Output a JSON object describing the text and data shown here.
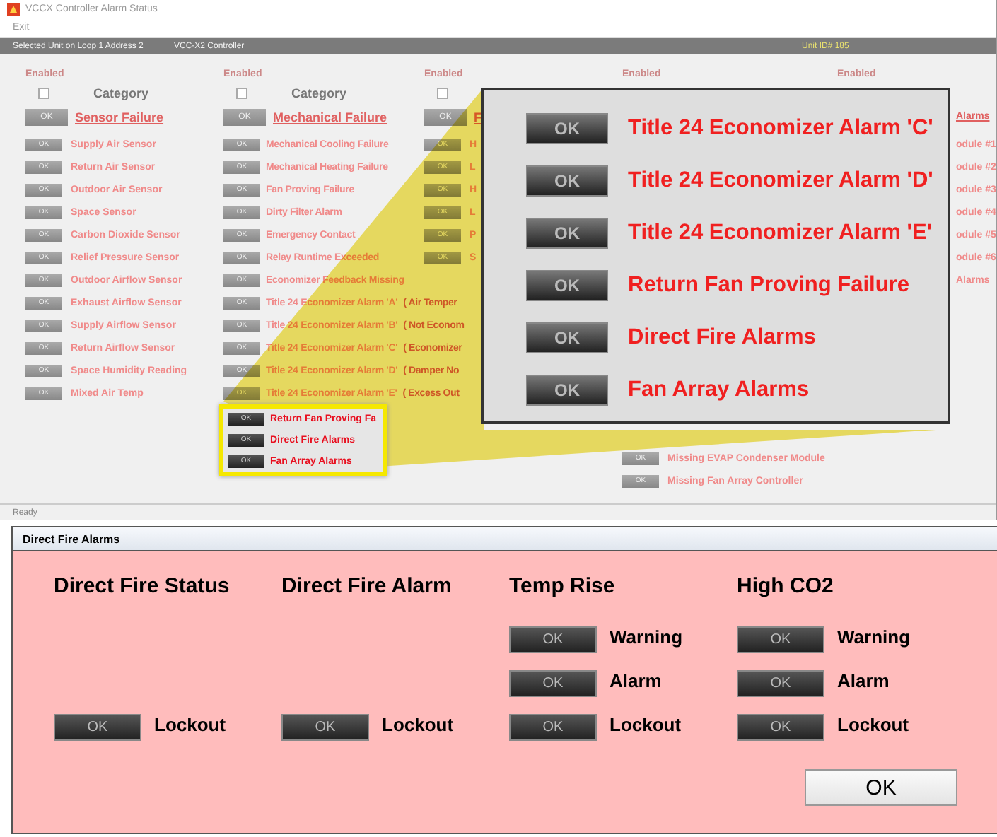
{
  "window": {
    "title": "VCCX Controller Alarm Status",
    "menu": [
      "Exit"
    ],
    "info_bar": {
      "unit_location": "Selected Unit on Loop 1 Address 2",
      "controller": "VCC-X2 Controller",
      "unit_id": "Unit ID# 185"
    },
    "status_bar": "Ready"
  },
  "columns": [
    {
      "kind": "full",
      "enabled_label": "Enabled",
      "checkbox": {
        "checked": false
      },
      "category_label": "Category",
      "category": {
        "button": "OK",
        "name": "Sensor Failure"
      },
      "items": [
        {
          "button": "OK",
          "label": "Supply Air Sensor"
        },
        {
          "button": "OK",
          "label": "Return Air Sensor"
        },
        {
          "button": "OK",
          "label": "Outdoor Air Sensor"
        },
        {
          "button": "OK",
          "label": "Space Sensor"
        },
        {
          "button": "OK",
          "label": "Carbon Dioxide Sensor"
        },
        {
          "button": "OK",
          "label": "Relief Pressure Sensor"
        },
        {
          "button": "OK",
          "label": "Outdoor Airflow Sensor"
        },
        {
          "button": "OK",
          "label": "Exhaust Airflow Sensor"
        },
        {
          "button": "OK",
          "label": "Supply Airflow Sensor"
        },
        {
          "button": "OK",
          "label": "Return Airflow Sensor"
        },
        {
          "button": "OK",
          "label": "Space Humidity Reading"
        },
        {
          "button": "OK",
          "label": "Mixed Air Temp"
        }
      ]
    },
    {
      "kind": "full",
      "enabled_label": "Enabled",
      "checkbox": {
        "checked": false
      },
      "category_label": "Category",
      "category": {
        "button": "OK",
        "name": "Mechanical Failure"
      },
      "items": [
        {
          "button": "OK",
          "label": "Mechanical Cooling Failure"
        },
        {
          "button": "OK",
          "label": "Mechanical Heating Failure"
        },
        {
          "button": "OK",
          "label": "Fan Proving Failure"
        },
        {
          "button": "OK",
          "label": "Dirty Filter Alarm"
        },
        {
          "button": "OK",
          "label": "Emergency Contact"
        },
        {
          "button": "OK",
          "label": "Relay Runtime Exceeded"
        },
        {
          "button": "OK",
          "label": "Economizer Feedback Missing"
        },
        {
          "button": "OK",
          "label": "Title 24 Economizer Alarm 'A'",
          "note": "( Air Temper"
        },
        {
          "button": "OK",
          "label": "Title 24 Economizer Alarm 'B'",
          "note": "( Not Econom"
        },
        {
          "button": "OK",
          "label": "Title 24 Economizer Alarm 'C'",
          "note": "( Economizer"
        },
        {
          "button": "OK",
          "label": "Title 24 Economizer Alarm 'D'",
          "note": "( Damper No"
        },
        {
          "button": "OK",
          "label": "Title 24 Economizer Alarm 'E'",
          "note": "( Excess Out"
        }
      ],
      "highlight_box": [
        {
          "button": "OK",
          "label": "Return Fan Proving Fa"
        },
        {
          "button": "OK",
          "label": "Direct Fire Alarms"
        },
        {
          "button": "OK",
          "label": "Fan Array Alarms"
        }
      ]
    },
    {
      "kind": "full",
      "enabled_label": "Enabled",
      "checkbox": {
        "checked": false
      },
      "category": {
        "button": "OK",
        "name": "F"
      },
      "items": [
        {
          "button": "OK",
          "label": "H"
        },
        {
          "button": "OK",
          "label": "L"
        },
        {
          "button": "OK",
          "label": "H"
        },
        {
          "button": "OK",
          "label": "L"
        },
        {
          "button": "OK",
          "label": "P"
        },
        {
          "button": "OK",
          "label": "S"
        }
      ]
    },
    {
      "kind": "tail",
      "enabled_label": "Enabled",
      "items": [
        {
          "button": "OK",
          "label": "Missing EVAP Condenser Module"
        },
        {
          "button": "OK",
          "label": "Missing Fan Array Controller"
        }
      ]
    },
    {
      "kind": "clipped",
      "enabled_label": "Enabled",
      "category": {
        "name": "Alarms"
      },
      "items": [
        {
          "label": "odule #1"
        },
        {
          "label": "odule #2"
        },
        {
          "label": "odule #3"
        },
        {
          "label": "odule #4"
        },
        {
          "label": "odule #5"
        },
        {
          "label": "odule #6"
        },
        {
          "label": "Alarms"
        }
      ]
    }
  ],
  "magnifier": {
    "items": [
      {
        "button": "OK",
        "label": "Title 24 Economizer Alarm 'C'"
      },
      {
        "button": "OK",
        "label": "Title 24 Economizer Alarm 'D'"
      },
      {
        "button": "OK",
        "label": "Title 24 Economizer Alarm 'E'"
      },
      {
        "button": "OK",
        "label": "Return Fan Proving Failure"
      },
      {
        "button": "OK",
        "label": "Direct Fire Alarms"
      },
      {
        "button": "OK",
        "label": "Fan Array Alarms"
      }
    ]
  },
  "dialog": {
    "title": "Direct Fire Alarms",
    "columns": [
      {
        "heading": "Direct Fire Status",
        "rows": [
          {
            "button": "OK",
            "label": "Lockout"
          }
        ]
      },
      {
        "heading": "Direct Fire Alarm",
        "rows": [
          {
            "button": "OK",
            "label": "Lockout"
          }
        ]
      },
      {
        "heading": "Temp Rise",
        "rows": [
          {
            "button": "OK",
            "label": "Warning"
          },
          {
            "button": "OK",
            "label": "Alarm"
          },
          {
            "button": "OK",
            "label": "Lockout"
          }
        ]
      },
      {
        "heading": "High CO2",
        "rows": [
          {
            "button": "OK",
            "label": "Warning"
          },
          {
            "button": "OK",
            "label": "Alarm"
          },
          {
            "button": "OK",
            "label": "Lockout"
          }
        ]
      }
    ],
    "ok_button": "OK"
  }
}
